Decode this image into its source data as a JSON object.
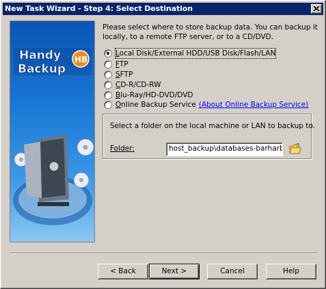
{
  "window": {
    "title": "New Task Wizard - Step 4: Select Destination"
  },
  "branding": {
    "logo_line1": "Handy",
    "logo_line2": "Backup",
    "logo_badge": "HB"
  },
  "intro": {
    "line1": "Please select where to store backup data. You can backup it",
    "line2": "locally, to a remote FTP server, or to a CD/DVD."
  },
  "destinations": [
    {
      "label": "Local Disk/External HDD/USB Disk/Flash/LAN",
      "selected": true
    },
    {
      "label": "FTP",
      "selected": false
    },
    {
      "label": "SFTP",
      "selected": false
    },
    {
      "label": "CD-R/CD-RW",
      "selected": false
    },
    {
      "label": "Blu-Ray/HD-DVD/DVD",
      "selected": false
    },
    {
      "label": "Online Backup Service",
      "selected": false,
      "link": "(About Online Backup Service)"
    }
  ],
  "folder_group": {
    "description": "Select a folder on the local machine or LAN to backup to.",
    "folder_label": "Folder:",
    "folder_value": "host_backup\\databases-barharbor"
  },
  "buttons": {
    "back": "< Back",
    "next": "Next >",
    "cancel": "Cancel",
    "help": "Help"
  },
  "colors": {
    "titlebar": "#0a246a",
    "face": "#d4d0c8",
    "link": "#0000ff",
    "panel_top": "#0a55b5",
    "panel_bottom": "#8ec8f2"
  }
}
